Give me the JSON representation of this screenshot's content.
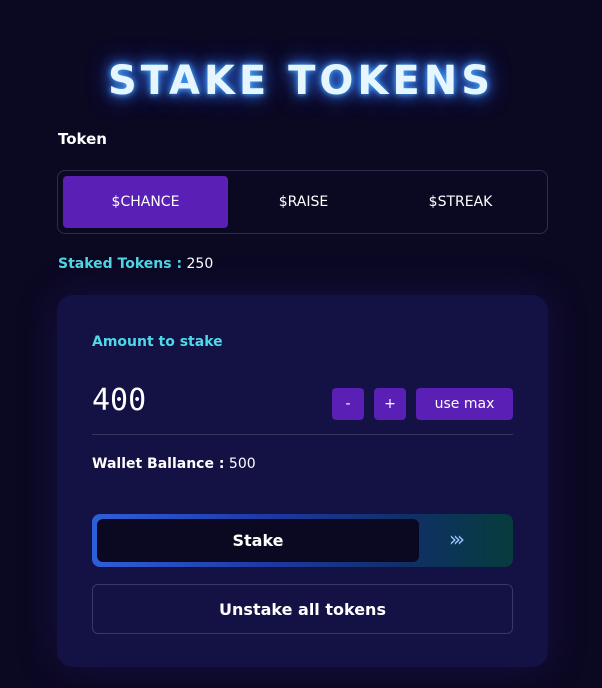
{
  "page": {
    "title": "STAKE TOKENS"
  },
  "token": {
    "label": "Token",
    "tabs": [
      {
        "label": "$CHANCE",
        "active": true
      },
      {
        "label": "$RAISE",
        "active": false
      },
      {
        "label": "$STREAK",
        "active": false
      }
    ]
  },
  "staked": {
    "label": "Staked Tokens :",
    "value": "250"
  },
  "card": {
    "amount_label": "Amount to stake",
    "amount_value": "400",
    "minus_label": "-",
    "plus_label": "+",
    "use_max_label": "use max",
    "wallet_label": "Wallet Ballance :",
    "wallet_value": "500",
    "stake_label": "Stake",
    "chevrons": "›››",
    "unstake_label": "Unstake all tokens"
  },
  "colors": {
    "background": "#0b0822",
    "card": "#141144",
    "accent_purple": "#5a1fb4",
    "accent_cyan": "#4fd8e6"
  }
}
